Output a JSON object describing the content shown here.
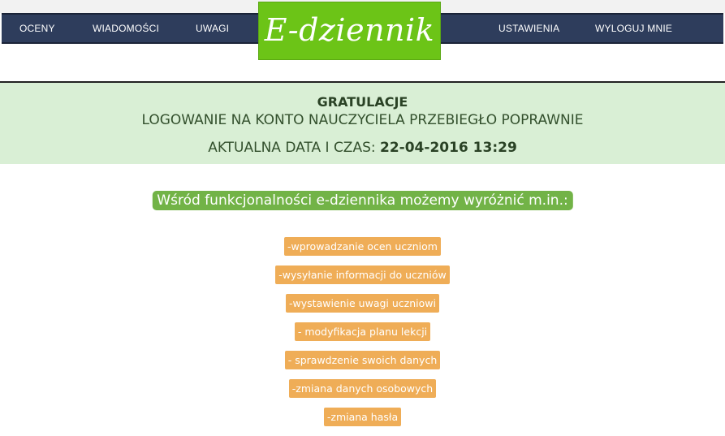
{
  "nav": {
    "left": [
      "OCENY",
      "WIADOMOŚCI",
      "UWAGI"
    ],
    "right": [
      "USTAWIENIA",
      "WYLOGUJ MNIE"
    ]
  },
  "logo": {
    "text": "E-dziennik"
  },
  "banner": {
    "title": "GRATULACJE",
    "subtitle": "LOGOWANIE NA KONTO NAUCZYCIELA PRZEBIEGŁO POPRAWNIE",
    "date_label": "AKTUALNA DATA I CZAS:",
    "date_value": "22-04-2016 13:29"
  },
  "features": {
    "heading": "Wśród funkcjonalności e-dziennika możemy wyróżnić m.in.:",
    "items": [
      "-wprowadzanie ocen uczniom",
      "-wysyłanie informacji do uczniów",
      "-wystawienie uwagi uczniowi",
      "- modyfikacja planu lekcji",
      "- sprawdzenie swoich danych",
      "-zmiana danych osobowych",
      "-zmiana hasła"
    ]
  },
  "colors": {
    "navbar": "#2e3d5c",
    "logo": "#6cc417",
    "banner": "#d9efd5",
    "heading_badge": "#72b347",
    "feature_badge": "#efad57"
  }
}
